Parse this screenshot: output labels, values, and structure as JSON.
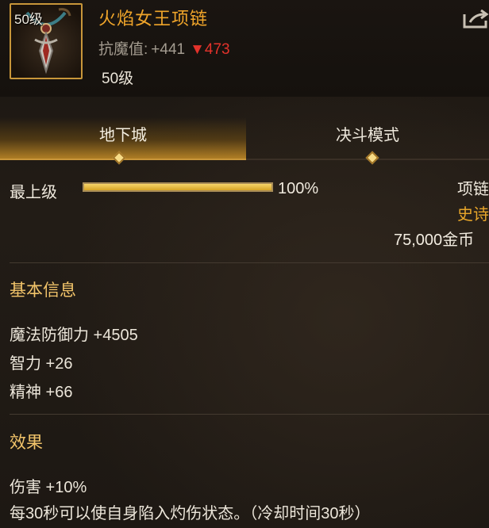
{
  "item": {
    "icon_name": "necklace-icon",
    "icon_level": "50级",
    "name": "火焰女王项链",
    "resist_label": "抗魔值:",
    "resist_value": "+441",
    "resist_down_arrow": "▼",
    "resist_down_value": "473",
    "level": "50级"
  },
  "tabs": [
    {
      "label": "地下城",
      "active": true
    },
    {
      "label": "决斗模式",
      "active": false
    }
  ],
  "max_level": {
    "label": "最上级",
    "progress": 1.0,
    "progress_text": "100%"
  },
  "meta": {
    "type": "项链",
    "rarity": "史诗",
    "price": "75,000金币"
  },
  "basic_info": {
    "title": "基本信息",
    "stats": [
      "魔法防御力 +4505",
      "智力 +26",
      "精神 +66"
    ]
  },
  "effects": {
    "title": "效果",
    "lines": [
      "伤害 +10%",
      "每30秒可以使自身陷入灼伤状态。（冷却时间30秒）"
    ]
  },
  "colors": {
    "name": "#f0a52a",
    "rarity": "#e8a62a",
    "down": "#e3322b",
    "accent": "#c8963a"
  }
}
